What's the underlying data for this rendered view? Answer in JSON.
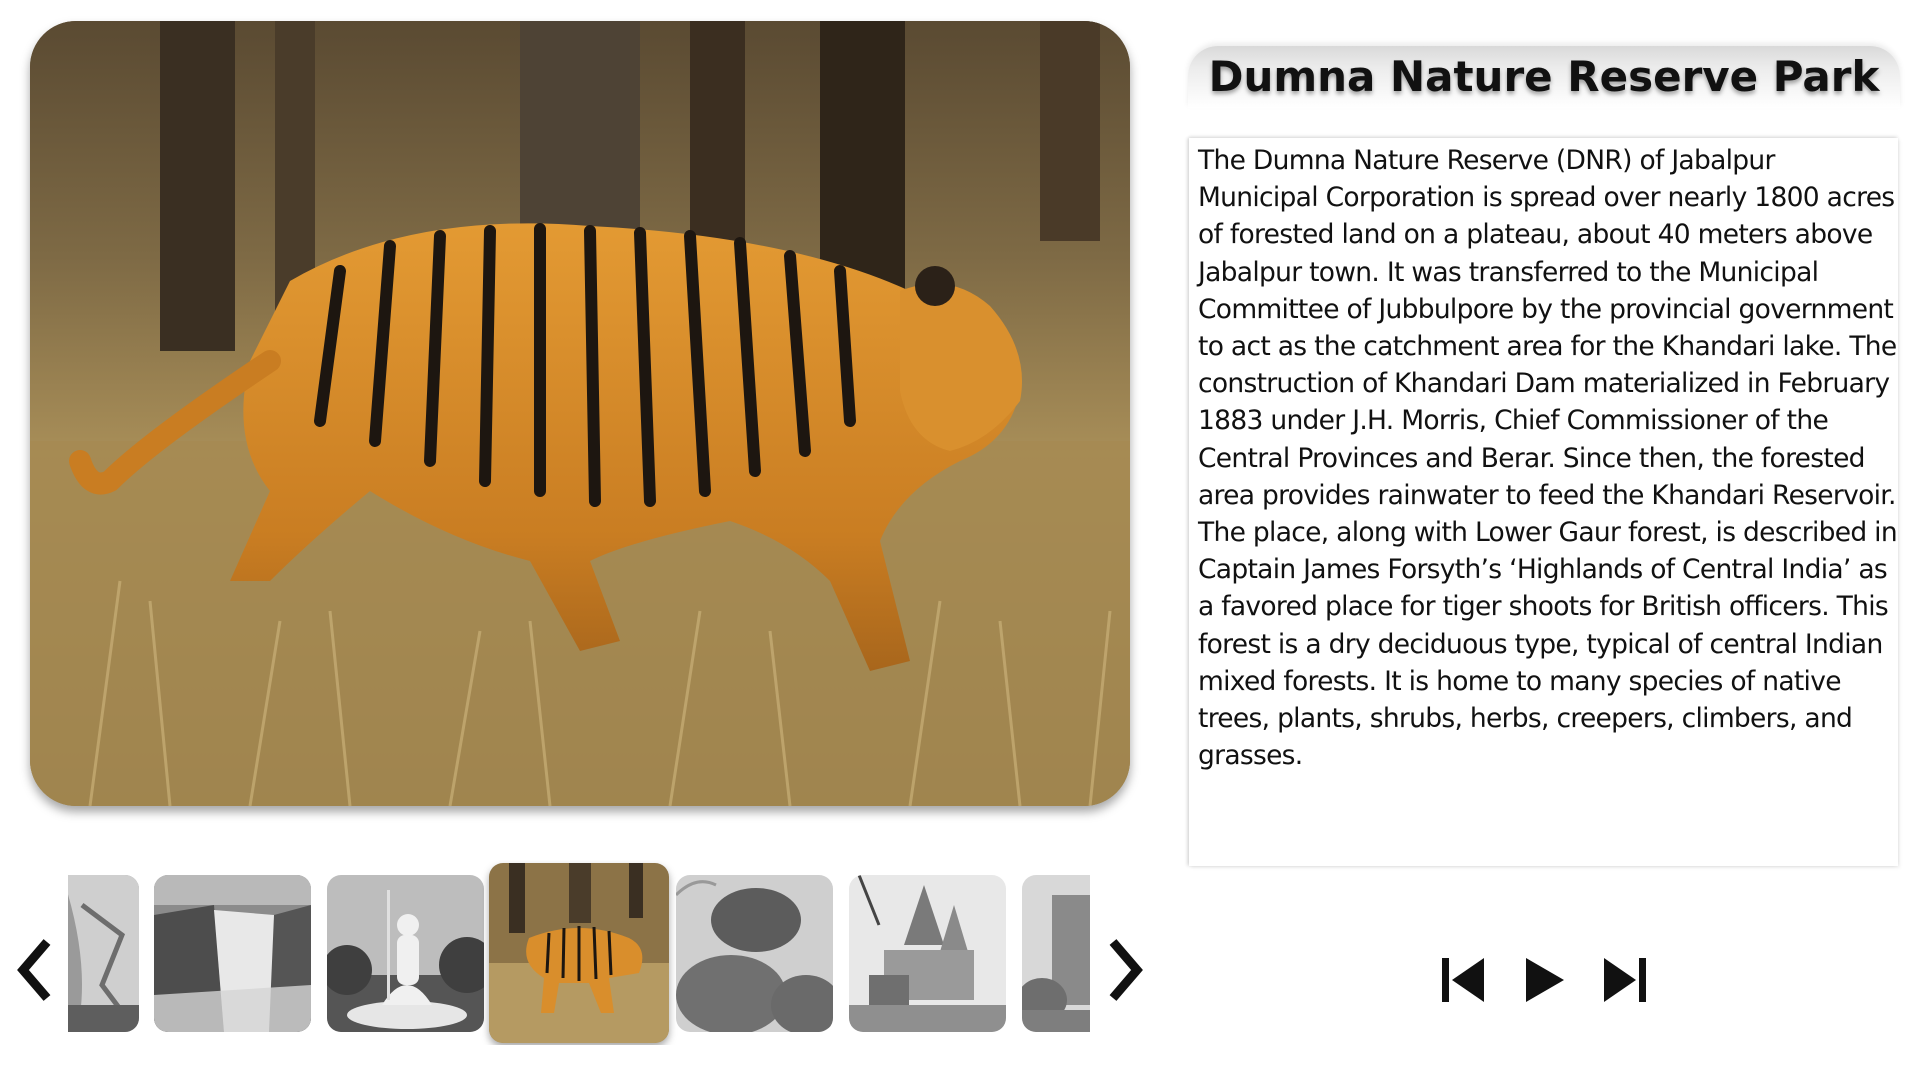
{
  "title": "Dumna Nature Reserve Park",
  "description": "The Dumna Nature Reserve (DNR) of Jabalpur Municipal Corporation is spread over nearly 1800 acres of forested land on a plateau, about 40 meters above Jabalpur town. It was transferred to the Municipal Committee of Jubbulpore by the provincial government to act as the catchment area for the Khandari lake. The construction of Khandari Dam materialized in February 1883 under J.H. Morris, Chief Commissioner of the Central Provinces and Berar. Since then, the forested area provides rainwater to feed the Khandari Reservoir. The place, along with Lower Gaur forest, is described in Captain James Forsyth’s ‘Highlands of Central India’ as a favored place for tiger shoots for British officers. This forest is a dry deciduous type, typical of central Indian mixed forests. It is home to many species of native trees, plants, shrubs, herbs, creepers, climbers, and grasses.",
  "main_image": {
    "subject": "tiger walking through dry grass",
    "icon": "tiger-photo"
  },
  "thumbnails": [
    {
      "subject": "marble rocks",
      "style": "grayscale",
      "active": false
    },
    {
      "subject": "waterfall",
      "style": "grayscale",
      "active": false
    },
    {
      "subject": "shiva statue",
      "style": "grayscale",
      "active": false
    },
    {
      "subject": "tiger",
      "style": "color",
      "active": true
    },
    {
      "subject": "balancing rock",
      "style": "grayscale",
      "active": false
    },
    {
      "subject": "temple",
      "style": "grayscale",
      "active": false
    },
    {
      "subject": "fort",
      "style": "grayscale",
      "active": false
    }
  ],
  "strip_nav": {
    "prev_icon": "chevron-left-icon",
    "next_icon": "chevron-right-icon"
  },
  "controls": {
    "previous_icon": "skip-previous-icon",
    "play_icon": "play-icon",
    "next_icon": "skip-next-icon"
  },
  "colors": {
    "text": "#111111",
    "background": "#ffffff",
    "tiger": "#d18a2a"
  }
}
